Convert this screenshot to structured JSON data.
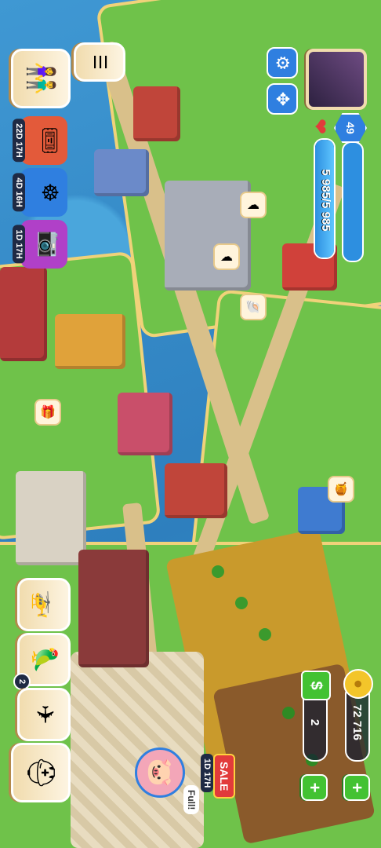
{
  "hud": {
    "level": "49",
    "energy": "5 985/5 985",
    "energy_fill_fraction": 1.0,
    "coins": "72 716",
    "cash": "2",
    "piggy_status": "Full!",
    "sale_label": "SALE",
    "sale_timer": "1D 17H",
    "chat_icon": "chat-icon"
  },
  "event_timers": [
    {
      "name": "ticket-event",
      "label": "22D 17H",
      "color": "#e35a3a",
      "icon": "ticket-icon"
    },
    {
      "name": "helm-event",
      "label": "4D 16H",
      "color": "#2f7fe0",
      "icon": "ship-wheel-icon"
    },
    {
      "name": "camera-event",
      "label": "1D 17H",
      "color": "#b040c8",
      "icon": "camera-icon"
    }
  ],
  "bottom_buttons": [
    {
      "name": "helicopter",
      "icon": "helicopter-icon"
    },
    {
      "name": "parrot",
      "icon": "parrot-icon",
      "badge": "2"
    },
    {
      "name": "airplane",
      "icon": "airplane-icon"
    },
    {
      "name": "hard-hat",
      "icon": "hard-hat-icon"
    }
  ],
  "colors": {
    "accent_blue": "#2f7fe0",
    "plus_green": "#43c232",
    "sale_red": "#e23b3b",
    "tile_bg": "#fdf4e1"
  }
}
